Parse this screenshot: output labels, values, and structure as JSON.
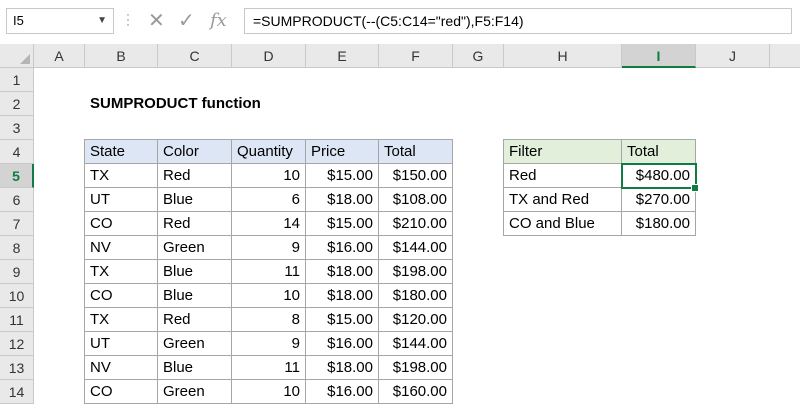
{
  "name_box": {
    "value": "I5"
  },
  "formula_bar": {
    "cancel_icon": "x-icon",
    "enter_icon": "check-icon",
    "function_icon": "fx-icon",
    "formula": "=SUMPRODUCT(--(C5:C14=\"red\"),F5:F14)"
  },
  "columns": [
    "A",
    "B",
    "C",
    "D",
    "E",
    "F",
    "G",
    "H",
    "I",
    "J"
  ],
  "rows": [
    "1",
    "2",
    "3",
    "4",
    "5",
    "6",
    "7",
    "8",
    "9",
    "10",
    "11",
    "12",
    "13",
    "14"
  ],
  "selected": {
    "column": "I",
    "row": "5"
  },
  "title": "SUMPRODUCT function",
  "data_table": {
    "headers": [
      "State",
      "Color",
      "Quantity",
      "Price",
      "Total"
    ],
    "rows": [
      [
        "TX",
        "Red",
        "10",
        "$15.00",
        "$150.00"
      ],
      [
        "UT",
        "Blue",
        "6",
        "$18.00",
        "$108.00"
      ],
      [
        "CO",
        "Red",
        "14",
        "$15.00",
        "$210.00"
      ],
      [
        "NV",
        "Green",
        "9",
        "$16.00",
        "$144.00"
      ],
      [
        "TX",
        "Blue",
        "11",
        "$18.00",
        "$198.00"
      ],
      [
        "CO",
        "Blue",
        "10",
        "$18.00",
        "$180.00"
      ],
      [
        "TX",
        "Red",
        "8",
        "$15.00",
        "$120.00"
      ],
      [
        "UT",
        "Green",
        "9",
        "$16.00",
        "$144.00"
      ],
      [
        "NV",
        "Blue",
        "11",
        "$18.00",
        "$198.00"
      ],
      [
        "CO",
        "Green",
        "10",
        "$16.00",
        "$160.00"
      ]
    ]
  },
  "summary_table": {
    "headers": [
      "Filter",
      "Total"
    ],
    "rows": [
      [
        "Red",
        "$480.00"
      ],
      [
        "TX and Red",
        "$270.00"
      ],
      [
        "CO and Blue",
        "$180.00"
      ]
    ]
  },
  "colors": {
    "accent": "#107c41",
    "data_header_fill": "#dce6f5",
    "summary_header_fill": "#e2efda"
  }
}
